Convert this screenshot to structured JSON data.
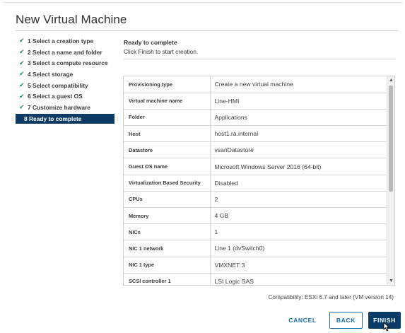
{
  "dialog": {
    "title": "New Virtual Machine"
  },
  "steps": [
    {
      "label": "1 Select a creation type",
      "done": true
    },
    {
      "label": "2 Select a name and folder",
      "done": true
    },
    {
      "label": "3 Select a compute resource",
      "done": true
    },
    {
      "label": "4 Select storage",
      "done": true
    },
    {
      "label": "5 Select compatibility",
      "done": true
    },
    {
      "label": "6 Select a guest OS",
      "done": true
    },
    {
      "label": "7 Customize hardware",
      "done": true
    },
    {
      "label": "8 Ready to complete",
      "done": false,
      "current": true
    }
  ],
  "pane": {
    "title": "Ready to complete",
    "subtitle": "Click Finish to start creation."
  },
  "summary": [
    {
      "key": "Provisioning type",
      "value": "Create a new virtual machine"
    },
    {
      "key": "Virtual machine name",
      "value": "Line-HMI"
    },
    {
      "key": "Folder",
      "value": "Applications"
    },
    {
      "key": "Host",
      "value": "host1.ra.internal"
    },
    {
      "key": "Datastore",
      "value": "vsanDatastore"
    },
    {
      "key": "Guest OS name",
      "value": "Microsoft Windows Server 2016 (64-bit)"
    },
    {
      "key": "Virtualization Based Security",
      "value": "Disabled"
    },
    {
      "key": "CPUs",
      "value": "2"
    },
    {
      "key": "Memory",
      "value": "4 GB"
    },
    {
      "key": "NICs",
      "value": "1"
    },
    {
      "key": "NIC 1 network",
      "value": "Line 1 (dvSwitch0)"
    },
    {
      "key": "NIC 1 type",
      "value": "VMXNET 3"
    },
    {
      "key": "SCSI controller 1",
      "value": "LSI Logic SAS"
    }
  ],
  "compatibility": "Compatibility: ESXi 6.7 and later (VM version 14)",
  "buttons": {
    "cancel": "CANCEL",
    "back": "BACK",
    "finish": "FINISH"
  },
  "icons": {
    "step_done": "check-icon",
    "scroll_up": "chevron-up-icon",
    "scroll_down": "chevron-down-icon",
    "pointer": "mouse-pointer-icon"
  },
  "colors": {
    "accent": "#0b3c68",
    "link": "#1a6fb0",
    "check": "#2e8b57"
  }
}
